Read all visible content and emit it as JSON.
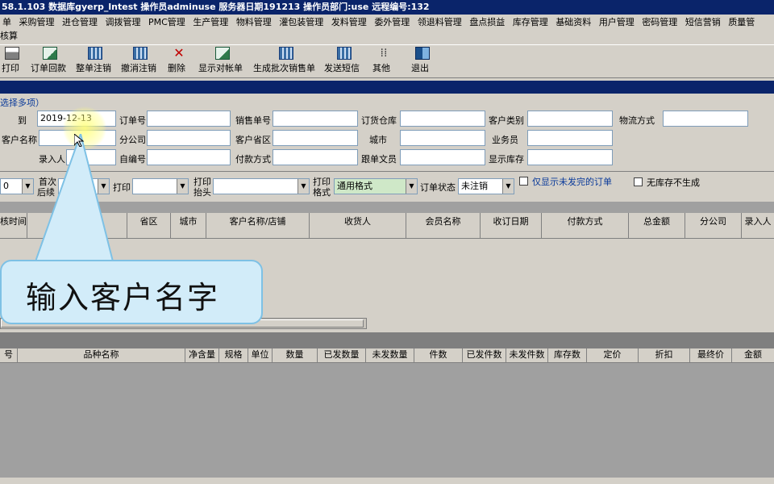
{
  "titlebar": {
    "text": "58.1.103  数据库gyerp_lntest  操作员adminuse  服务器日期191213  操作员部门:use 远程编号:132"
  },
  "menu": [
    "单",
    "采购管理",
    "进仓管理",
    "调拨管理",
    "PMC管理",
    "生产管理",
    "物料管理",
    "灌包装管理",
    "发料管理",
    "委外管理",
    "领退料管理",
    "盘点损益",
    "库存管理",
    "基础资料",
    "用户管理",
    "密码管理",
    "短信营销",
    "质量管"
  ],
  "menu2": "核算",
  "toolbar": [
    {
      "label": "打印",
      "icon": "print-icon"
    },
    {
      "label": "订单回款",
      "icon": "doc-icon"
    },
    {
      "label": "整单注销",
      "icon": "grid-icon"
    },
    {
      "label": "撤消注销",
      "icon": "grid-icon"
    },
    {
      "label": "删除",
      "icon": "delete-icon"
    },
    {
      "label": "显示对帐单",
      "icon": "doc-icon"
    },
    {
      "label": "生成批次销售单",
      "icon": "grid-icon"
    },
    {
      "label": "发送短信",
      "icon": "grid-icon"
    },
    {
      "label": "其他",
      "icon": "other-icon"
    },
    {
      "label": "退出",
      "icon": "exit-icon"
    }
  ],
  "filters": {
    "hint": "选择多项）",
    "to_label": "到",
    "date_value": "2019-12-13",
    "order_no_label": "订单号",
    "sales_no_label": "销售单号",
    "order_warehouse_label": "订货仓库",
    "customer_type_label": "客户类别",
    "logistics_label": "物流方式",
    "customer_name_label": "客户名称",
    "branch_label": "分公司",
    "customer_province_label": "客户省区",
    "city_label": "城市",
    "salesman_label": "业务员",
    "entry_label": "录入人",
    "self_code_label": "自编号",
    "payment_label": "付款方式",
    "follow_clerk_label": "跟单文员",
    "show_stock_label": "显示库存"
  },
  "options": {
    "first_follow_label_1": "首次",
    "first_follow_label_2": "后续",
    "print_label": "打印",
    "print_header_label_1": "打印",
    "print_header_label_2": "抬头",
    "print_format_label_1": "打印",
    "print_format_label_2": "格式",
    "print_format_value": "通用格式",
    "order_status_label": "订单状态",
    "order_status_value": "未注销",
    "unshipped_only_label": "仅显示未发完的订单",
    "no_stock_label": "无库存不生成",
    "left_combo_value": "0"
  },
  "grid1_columns": [
    "核时间",
    "",
    "省区",
    "城市",
    "客户名称/店铺",
    "收货人",
    "会员名称",
    "收订日期",
    "付款方式",
    "总金额",
    "分公司",
    "录入人"
  ],
  "grid2_columns": [
    "号",
    "品种名称",
    "净含量",
    "规格",
    "单位",
    "数量",
    "已发数量",
    "未发数量",
    "件数",
    "已发件数",
    "未发件数",
    "库存数",
    "定价",
    "折扣",
    "最终价",
    "金额"
  ],
  "callout": {
    "text": "输入客户名字"
  },
  "colors": {
    "title_bg": "#0a246a",
    "window_bg": "#d4d0c8",
    "callout_bg": "#d2ecf9",
    "callout_border": "#7ec1e5"
  }
}
